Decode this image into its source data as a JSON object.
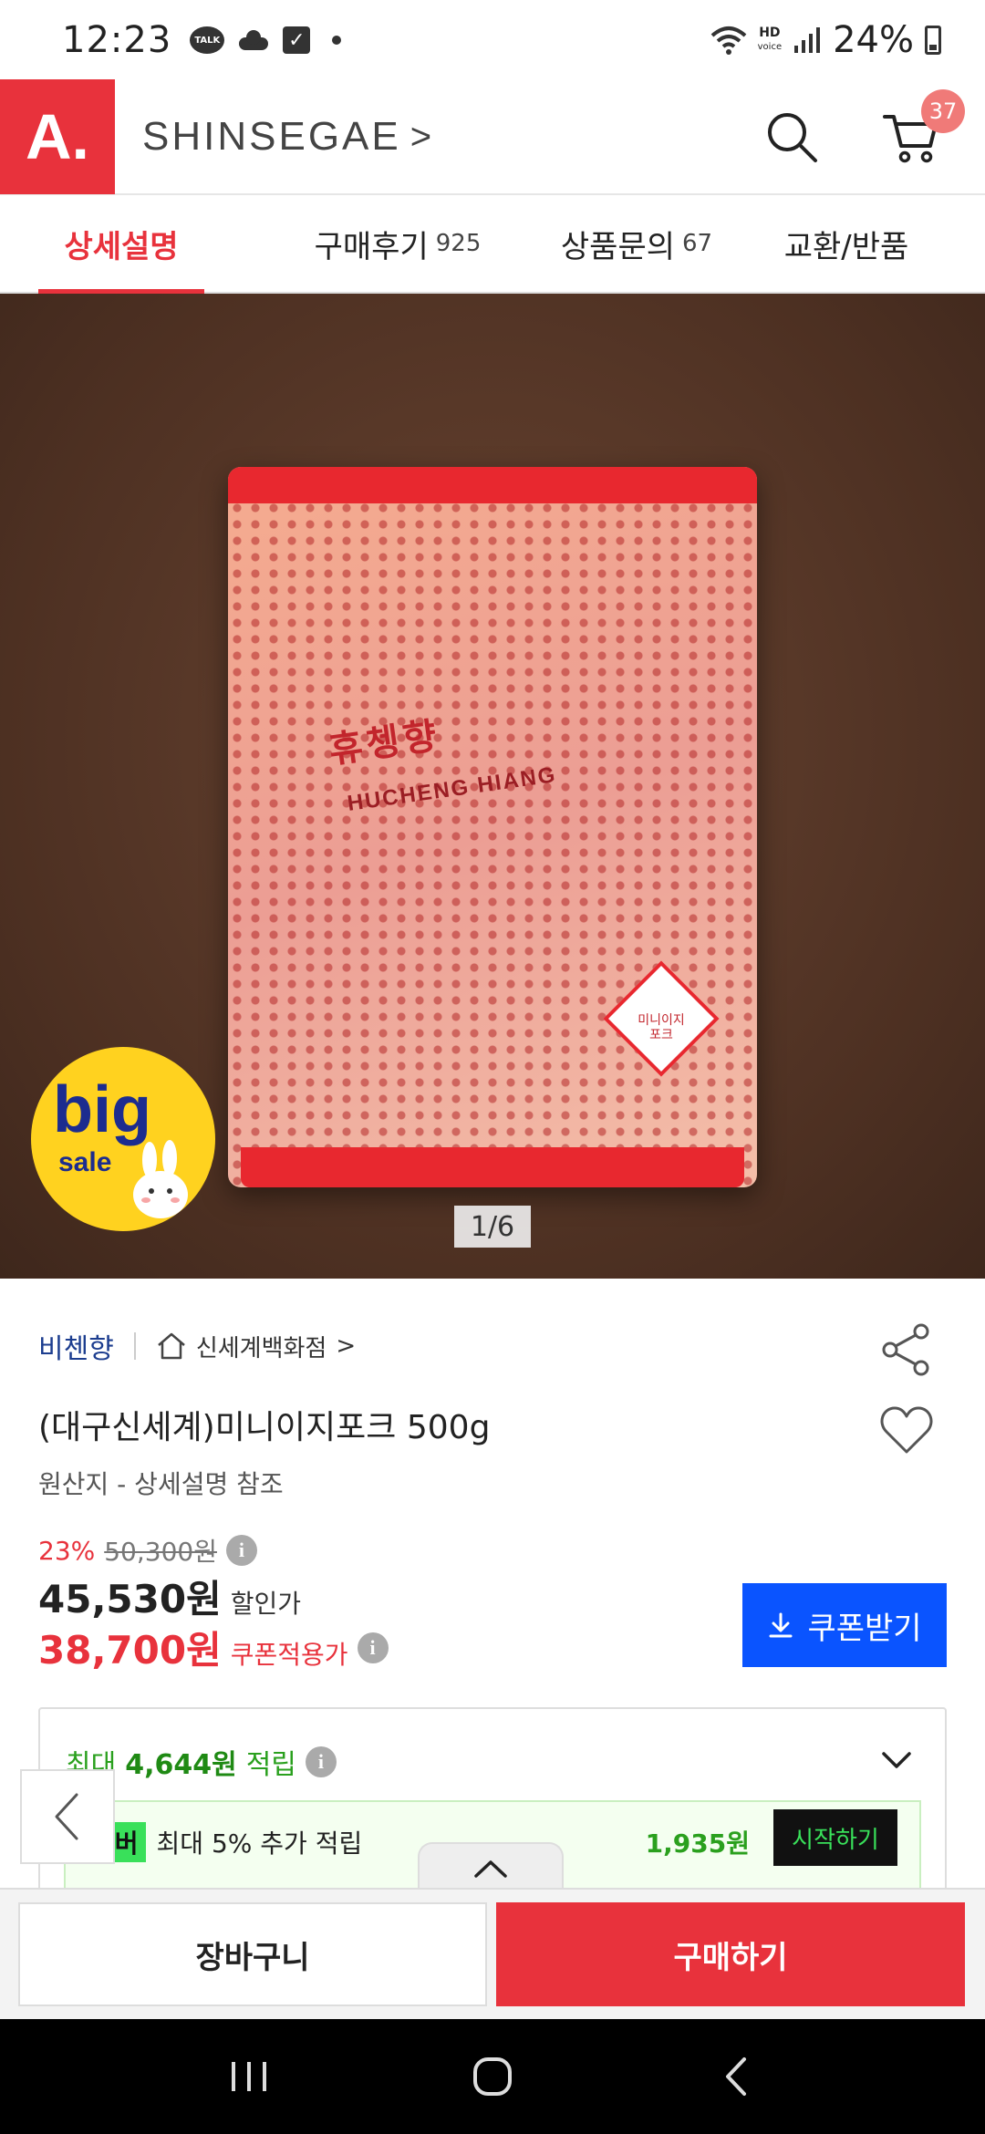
{
  "status_bar": {
    "time": "12:23",
    "talk_label": "TALK",
    "hd_voice": "HD",
    "hd_voice_sub": "voice",
    "battery": "24%"
  },
  "header": {
    "logo": "A.",
    "brand": "SHINSEGAE",
    "brand_chevron": ">",
    "cart_count": "37",
    "accent_color": "#e8323c"
  },
  "tabs": [
    {
      "label": "상세설명",
      "count": ""
    },
    {
      "label": "구매후기",
      "count": "925"
    },
    {
      "label": "상품문의",
      "count": "67"
    },
    {
      "label": "교환/반품",
      "count": ""
    }
  ],
  "product_image": {
    "bag_brand": "휴쳉향",
    "bag_brand_en": "HUCHENG HIANG",
    "bag_label": "미니이지포크",
    "big_sale_big": "big",
    "big_sale_sale": "sale",
    "page_indicator": "1/6"
  },
  "product": {
    "seller": "비첸향",
    "store": "신세계백화점",
    "store_chevron": ">",
    "title": "(대구신세계)미니이지포크  500g",
    "origin": "원산지 - 상세설명 참조",
    "discount_rate": "23%",
    "original_price": "50,300원",
    "sale_price": "45,530원",
    "sale_label": "할인가",
    "coupon_price": "38,700원",
    "coupon_label": "쿠폰적용가",
    "coupon_button": "쿠폰받기"
  },
  "reward": {
    "prefix": "최대",
    "amount": "4,644원",
    "suffix": "적립",
    "member_tag": "멤버",
    "member_text": "최대 5% 추가 적립",
    "member_amount": "1,935원",
    "start_button": "시작하기"
  },
  "actions": {
    "cart": "장바구니",
    "buy": "구매하기"
  },
  "colors": {
    "primary_red": "#e8323c",
    "coupon_blue": "#0a54ff",
    "reward_green": "#2aa01e"
  }
}
